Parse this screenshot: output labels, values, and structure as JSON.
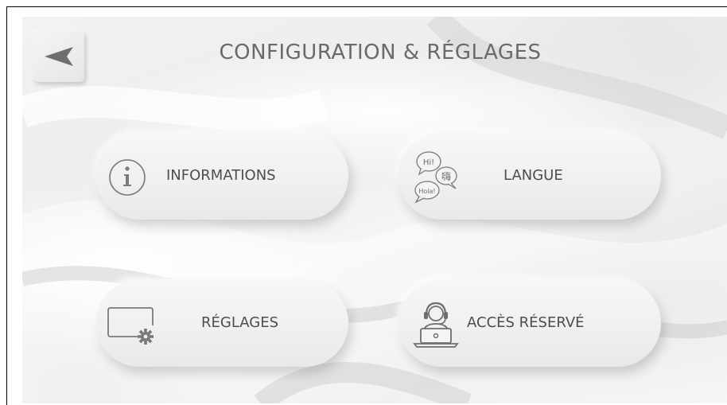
{
  "header": {
    "title": "CONFIGURATION & RÉGLAGES",
    "back_icon": "arrow-left-icon"
  },
  "menu": {
    "informations": {
      "label": "INFORMATIONS",
      "icon": "info-icon"
    },
    "langue": {
      "label": "LANGUE",
      "icon": "speech-bubbles-icon",
      "bubble_texts": [
        "Hi!",
        "嗨",
        "Hola!"
      ]
    },
    "reglages": {
      "label": "RÉGLAGES",
      "icon": "settings-screen-icon"
    },
    "acces_reserve": {
      "label": "ACCÈS RÉSERVÉ",
      "icon": "support-agent-icon"
    }
  },
  "colors": {
    "background": "#ededed",
    "pill": "#f2f2f2",
    "text": "#4d4d4d",
    "title": "#6a6a6a",
    "icon": "#7a7a7a",
    "back_arrow": "#6e6e6e"
  }
}
